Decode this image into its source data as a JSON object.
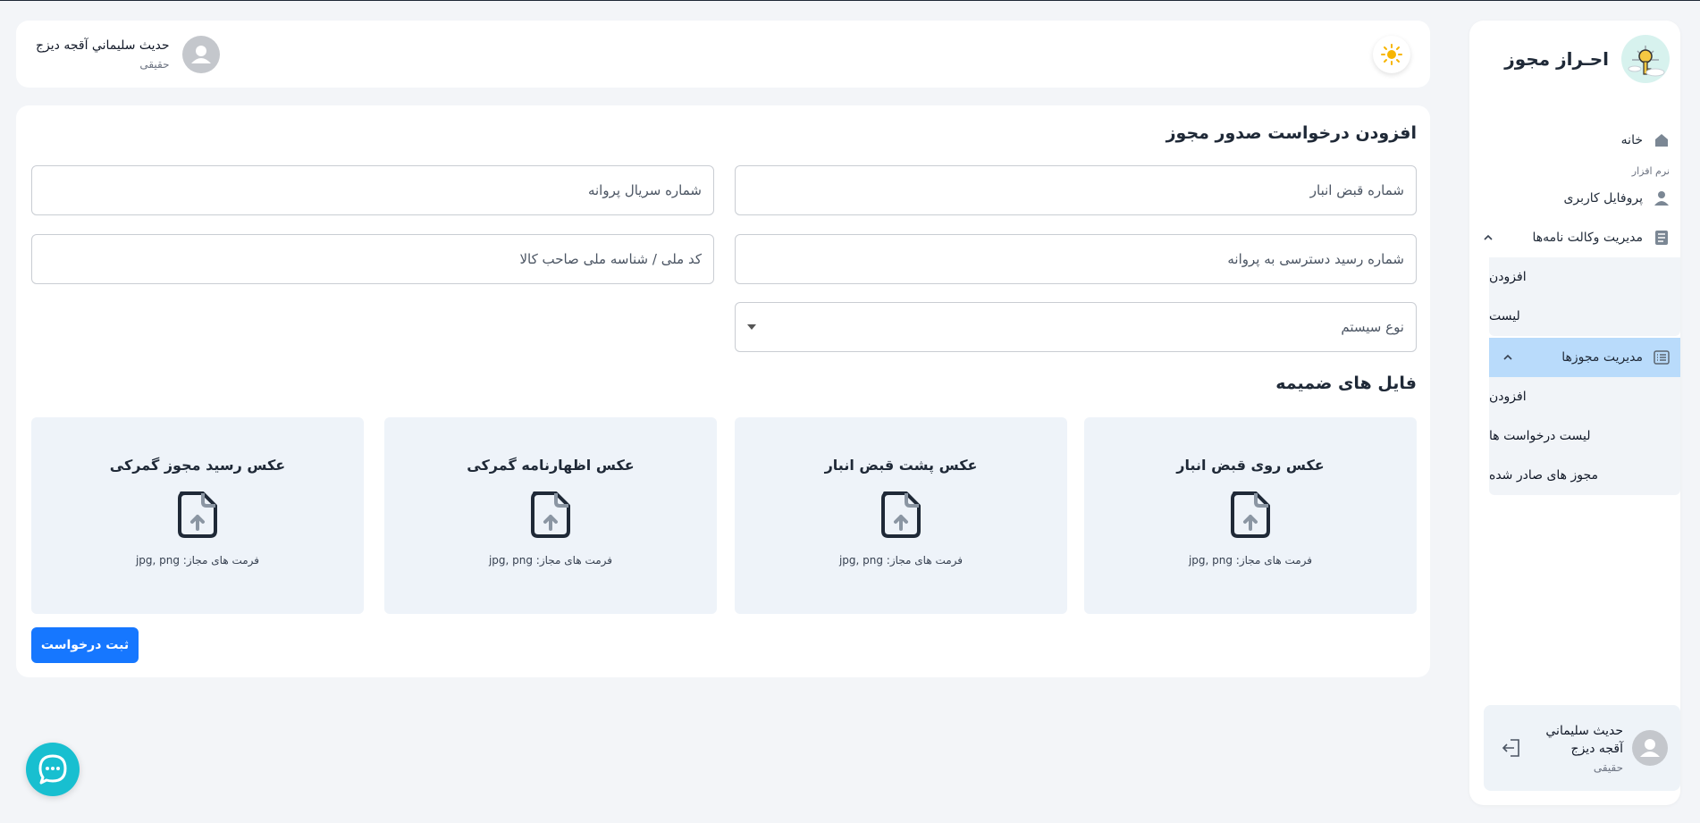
{
  "brand": {
    "title": "احـراز مجوز",
    "logo_icon": "key-idea-logo"
  },
  "sidebar": {
    "home_label": "خانه",
    "section_label": "نرم افزار",
    "profile_label": "پروفایل کاربری",
    "poa_group": {
      "label": "مدیریت وکالت نامه‌ها",
      "items": [
        "افزودن",
        "لیست"
      ]
    },
    "license_group": {
      "label": "مدیریت مجوزها",
      "items": [
        "افزودن",
        "لیست درخواست ها",
        "مجوز های صادر شده"
      ]
    },
    "user": {
      "name": "حدیث سلیماني آقجه دیزج",
      "role": "حقیقی"
    }
  },
  "header": {
    "user_name": "حدیث سلیماني آقجه دیزج",
    "user_role": "حقیقی",
    "theme_icon": "sun-icon"
  },
  "form": {
    "title": "افزودن درخواست صدور مجوز",
    "fields": {
      "warehouse_receipt": "شماره قبض انبار",
      "license_serial": "شماره سریال پروانه",
      "access_receipt": "شماره رسید دسترسی به پروانه",
      "national_code": "کد ملی / شناسه ملی صاحب کالا",
      "system_type": "نوع سیستم"
    },
    "attachments_title": "فایل های ضمیمه",
    "uploads": [
      {
        "title": "عکس روی قبض انبار",
        "hint": "فرمت های مجاز: jpg, png"
      },
      {
        "title": "عکس پشت قبض انبار",
        "hint": "فرمت های مجاز: jpg, png"
      },
      {
        "title": "عکس اظهارنامه گمرکی",
        "hint": "فرمت های مجاز: jpg, png"
      },
      {
        "title": "عکس رسید مجوز گمرکی",
        "hint": "فرمت های مجاز: jpg, png"
      }
    ],
    "submit_label": "ثبت درخواست"
  },
  "colors": {
    "primary": "#1677ff",
    "active_nav": "#b9dbfb",
    "chat": "#18bfd0"
  }
}
